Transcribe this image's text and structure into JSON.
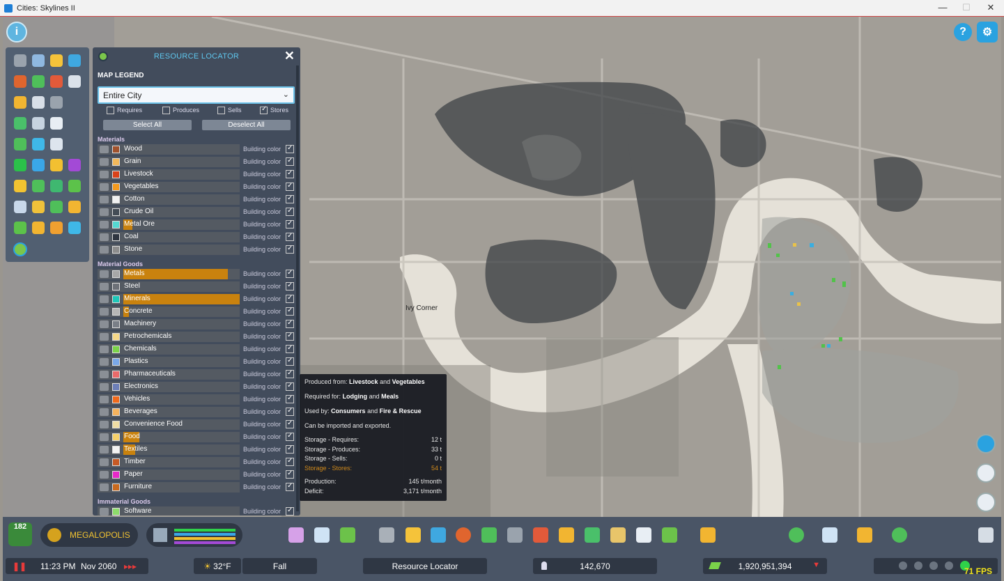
{
  "window": {
    "title": "Cities: Skylines II",
    "minimize": "—",
    "maximize": "☐",
    "close": "✕"
  },
  "map": {
    "place_label": "Ivy Corner"
  },
  "panel": {
    "title": "RESOURCE LOCATOR",
    "close": "✕",
    "legend_label": "MAP LEGEND",
    "scope": "Entire City",
    "filters": {
      "requires": "Requires",
      "produces": "Produces",
      "sells": "Sells",
      "stores": "Stores"
    },
    "select_all": "Select All",
    "deselect_all": "Deselect All",
    "building_color": "Building color",
    "sections": {
      "materials": "Materials",
      "material_goods": "Material Goods",
      "immaterial_goods": "Immaterial Goods"
    },
    "materials": [
      {
        "name": "Wood",
        "color": "#a0522d"
      },
      {
        "name": "Grain",
        "color": "#f2b85b"
      },
      {
        "name": "Livestock",
        "color": "#d9421a"
      },
      {
        "name": "Vegetables",
        "color": "#f39a1f"
      },
      {
        "name": "Cotton",
        "color": "#f1f1f1"
      },
      {
        "name": "Crude Oil",
        "color": "#444c56"
      },
      {
        "name": "Metal Ore",
        "color": "#54d9d2",
        "fill": 0.08
      },
      {
        "name": "Coal",
        "color": "#2f3540"
      },
      {
        "name": "Stone",
        "color": "#8d8d8d"
      }
    ],
    "material_goods": [
      {
        "name": "Metals",
        "color": "#a7a7a7",
        "fill": 0.9
      },
      {
        "name": "Steel",
        "color": "#6d7178"
      },
      {
        "name": "Minerals",
        "color": "#1ec7b9",
        "fill": 1.0
      },
      {
        "name": "Concrete",
        "color": "#b6b6b6",
        "fill": 0.05
      },
      {
        "name": "Machinery",
        "color": "#7a7f87"
      },
      {
        "name": "Petrochemicals",
        "color": "#f5d889"
      },
      {
        "name": "Chemicals",
        "color": "#7bd34a"
      },
      {
        "name": "Plastics",
        "color": "#7aa8e8"
      },
      {
        "name": "Pharmaceuticals",
        "color": "#e86a6a"
      },
      {
        "name": "Electronics",
        "color": "#6d7fb8"
      },
      {
        "name": "Vehicles",
        "color": "#f06a1c"
      },
      {
        "name": "Beverages",
        "color": "#f5b35e"
      },
      {
        "name": "Convenience Food",
        "color": "#f0dda4"
      },
      {
        "name": "Food",
        "color": "#f5d06a",
        "fill": 0.14
      },
      {
        "name": "Textiles",
        "color": "#f3f3f3",
        "fill": 0.1
      },
      {
        "name": "Timber",
        "color": "#c75a25"
      },
      {
        "name": "Paper",
        "color": "#e829c9"
      },
      {
        "name": "Furniture",
        "color": "#c96a1e"
      }
    ],
    "immaterial_goods": [
      {
        "name": "Software",
        "color": "#8ddc6b"
      }
    ]
  },
  "tooltip": {
    "produced_from_label": "Produced from:",
    "produced_from_a": "Livestock",
    "and": "and",
    "produced_from_b": "Vegetables",
    "required_for_label": "Required for:",
    "required_for_a": "Lodging",
    "required_for_b": "Meals",
    "used_by_label": "Used by:",
    "used_by_a": "Consumers",
    "used_by_b": "Fire & Rescue",
    "trade": "Can be imported and exported.",
    "storage": [
      {
        "label": "Storage - Requires:",
        "value": "12 t"
      },
      {
        "label": "Storage - Produces:",
        "value": "33 t"
      },
      {
        "label": "Storage - Sells:",
        "value": "0 t"
      },
      {
        "label": "Storage - Stores:",
        "value": "54 t"
      }
    ],
    "production_label": "Production:",
    "production_value": "145 t/month",
    "deficit_label": "Deficit:",
    "deficit_value": "3,171 t/month"
  },
  "bottom": {
    "level": "182",
    "milestone": "MEGALOPOLIS",
    "pause": "❚❚",
    "time": "11:23 PM",
    "date": "Nov 2060",
    "speed": "▸▸▸",
    "temperature": "32°F",
    "season": "Fall",
    "active_tool": "Resource Locator",
    "population": "142,670",
    "money": "1,920,951,394",
    "fps": "71 FPS"
  }
}
